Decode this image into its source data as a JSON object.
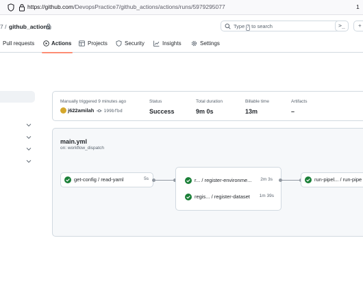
{
  "browser": {
    "url_host": "https://github.com",
    "url_path": "/DevopsPractice7/github_actions/actions/runs/5979295077",
    "edge_text": "1"
  },
  "repo": {
    "separator": "7 /",
    "name": "github_actions"
  },
  "search": {
    "placeholder_before": "Type",
    "key": "/",
    "placeholder_after": "to search",
    "command_label": ">_",
    "more_label": "+"
  },
  "tabs": [
    {
      "label": "Pull requests",
      "icon": "pull-request-icon"
    },
    {
      "label": "Actions",
      "icon": "play-icon",
      "active": true
    },
    {
      "label": "Projects",
      "icon": "table-icon"
    },
    {
      "label": "Security",
      "icon": "shield-icon"
    },
    {
      "label": "Insights",
      "icon": "graph-icon"
    },
    {
      "label": "Settings",
      "icon": "gear-icon"
    }
  ],
  "summary": {
    "trigger_label": "Manually triggered 9 minutes ago",
    "actor": "j622amilah",
    "commit": "199bfbd",
    "status_label": "Status",
    "status_value": "Success",
    "duration_label": "Total duration",
    "duration_value": "9m 0s",
    "billable_label": "Billable time",
    "billable_value": "13m",
    "artifacts_label": "Artifacts",
    "artifacts_value": "–"
  },
  "workflow": {
    "name": "main.yml",
    "trigger": "on: workflow_dispatch",
    "jobs": {
      "get_config": {
        "name": "get-config / read-yaml",
        "duration": "5s"
      },
      "register_env": {
        "name": "r... / register-environme...",
        "duration": "2m 3s"
      },
      "register_dataset": {
        "name": "regis... / register-dataset",
        "duration": "1m 39s"
      },
      "run_pipeline": {
        "name": "run-pipel... / run-pipe"
      }
    }
  },
  "colors": {
    "success": "#1a7f37",
    "active_tab_underline": "#fd8c73",
    "border": "#d1d9e0"
  }
}
